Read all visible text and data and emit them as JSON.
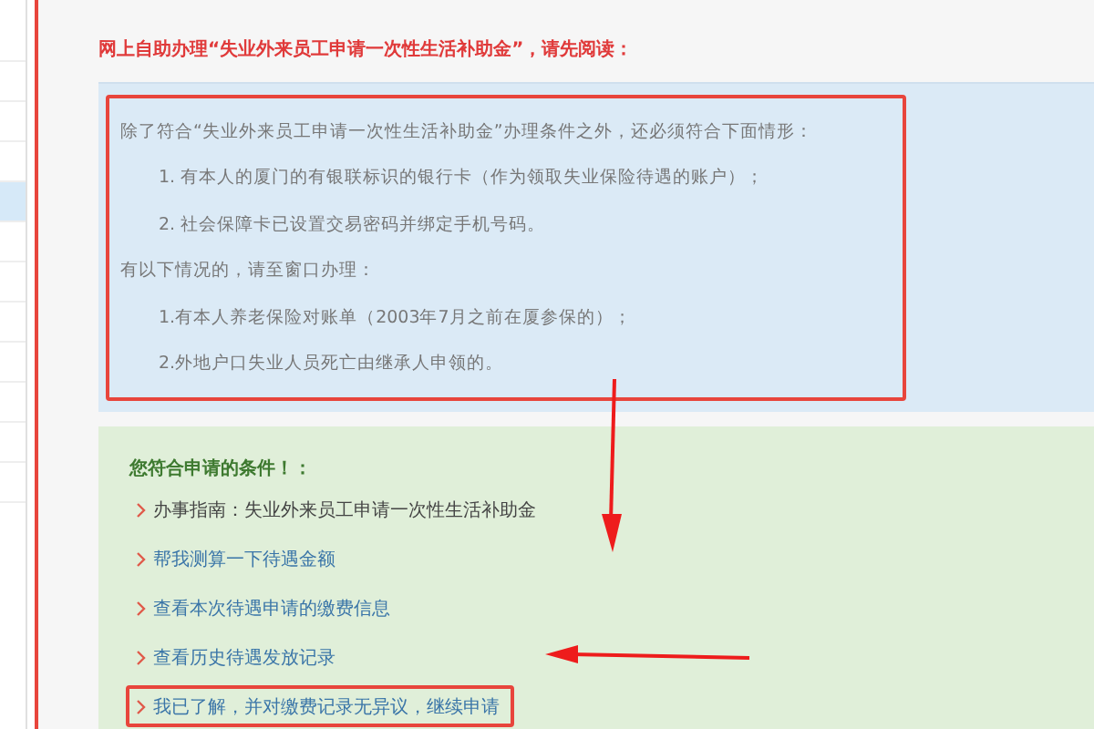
{
  "sidebar": {
    "items": [
      {
        "selected": false
      },
      {
        "selected": false
      },
      {
        "selected": false
      },
      {
        "selected": false
      },
      {
        "selected": true
      },
      {
        "selected": false
      },
      {
        "selected": false
      },
      {
        "selected": false
      },
      {
        "selected": false
      },
      {
        "selected": false
      },
      {
        "selected": false
      },
      {
        "selected": false
      }
    ]
  },
  "title": "网上自助办理“失业外来员工申请一次性生活补助金”，请先阅读：",
  "notice": {
    "highlighted": true,
    "lines": [
      {
        "kind": "para",
        "text": "除了符合“失业外来员工申请一次性生活补助金”办理条件之外，还必须符合下面情形："
      },
      {
        "kind": "indent",
        "text": "1. 有本人的厦门的有银联标识的银行卡（作为领取失业保险待遇的账户）；"
      },
      {
        "kind": "indent",
        "text": "2. 社会保障卡已设置交易密码并绑定手机号码。"
      },
      {
        "kind": "para",
        "text": "有以下情况的，请至窗口办理："
      },
      {
        "kind": "indent",
        "text": "1.有本人养老保险对账单（2003年7月之前在厦参保的）；"
      },
      {
        "kind": "indent",
        "text": "2.外地户口失业人员死亡由继承人申领的。"
      }
    ]
  },
  "conditions": {
    "heading": "您符合申请的条件！：",
    "items": [
      {
        "kind": "text",
        "text": "办事指南：失业外来员工申请一次性生活补助金",
        "highlighted": false
      },
      {
        "kind": "link",
        "text": "帮我测算一下待遇金额",
        "highlighted": false
      },
      {
        "kind": "link",
        "text": "查看本次待遇申请的缴费信息",
        "highlighted": false
      },
      {
        "kind": "link",
        "text": "查看历史待遇发放记录",
        "highlighted": false
      },
      {
        "kind": "link",
        "text": "我已了解，并对缴费记录无异议，继续申请",
        "highlighted": true
      }
    ]
  }
}
